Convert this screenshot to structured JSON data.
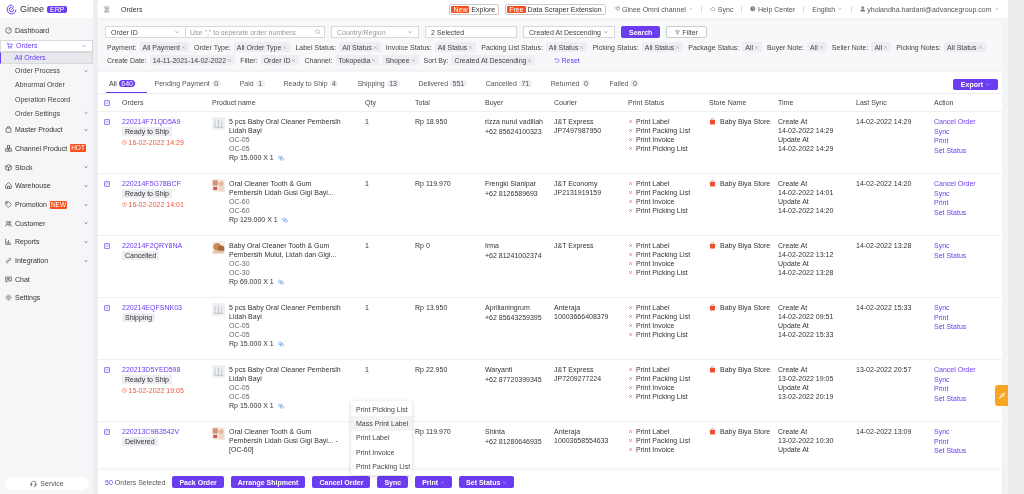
{
  "header": {
    "brand": "Ginee",
    "brand_badge": "ERP",
    "breadcrumb": "Orders",
    "promos": [
      {
        "badge": "New",
        "label": "Explore"
      },
      {
        "badge": "Free",
        "label": "Data Scraper Extension"
      }
    ],
    "menu": [
      {
        "kind": "channel",
        "label": "Ginee Omni channel"
      },
      {
        "kind": "sync",
        "label": "Sync"
      },
      {
        "kind": "help",
        "label": "Help Center"
      },
      {
        "kind": "language",
        "label": "English"
      },
      {
        "kind": "user",
        "label": "yholandha.hardani@advancegroup.com"
      }
    ]
  },
  "sidebar": {
    "items": [
      {
        "label": "Dashboard",
        "selected": false
      },
      {
        "label": "Orders",
        "selected": true,
        "expanded": true,
        "children": [
          {
            "label": "All Orders",
            "selected": true
          },
          {
            "label": "Order Process",
            "selected": false,
            "expanded": false
          },
          {
            "label": "Abnormal Order",
            "selected": false
          },
          {
            "label": "Operation Record",
            "selected": false
          },
          {
            "label": "Order Settings",
            "selected": false,
            "expanded": false
          }
        ]
      },
      {
        "label": "Master Product",
        "selected": false,
        "expanded": false
      },
      {
        "label": "Channel Product",
        "selected": false,
        "badge": "HOT"
      },
      {
        "label": "Stock",
        "selected": false,
        "expanded": false
      },
      {
        "label": "Warehouse",
        "selected": false,
        "expanded": false
      },
      {
        "label": "Promotion",
        "selected": false,
        "expanded": false,
        "badge": "NEW"
      },
      {
        "label": "Customer",
        "selected": false,
        "expanded": false
      },
      {
        "label": "Reports",
        "selected": false,
        "expanded": false
      },
      {
        "label": "Integration",
        "selected": false,
        "expanded": false
      },
      {
        "label": "Chat",
        "selected": false
      },
      {
        "label": "Settings",
        "selected": false
      }
    ],
    "service": "Service"
  },
  "search": {
    "field_select": "Order ID",
    "placeholder": "Use \",\" to seperate order numbers",
    "country_placeholder": "Country/Region",
    "channels": "2 Selected",
    "sort": "Created At Descending",
    "search_button": "Search",
    "filter_button": "Filter"
  },
  "filters": [
    {
      "label": "Payment:",
      "tags": [
        "All Payment"
      ]
    },
    {
      "label": "Order Type:",
      "tags": [
        "All Order Type"
      ]
    },
    {
      "label": "Label Status:",
      "tags": [
        "All Status"
      ]
    },
    {
      "label": "Invoice Status:",
      "tags": [
        "All Status"
      ]
    },
    {
      "label": "Packing List Status:",
      "tags": [
        "All Status"
      ]
    },
    {
      "label": "Picking Status:",
      "tags": [
        "All Status"
      ]
    },
    {
      "label": "Package Status:",
      "tags": [
        "All"
      ]
    },
    {
      "label": "Buyer Note:",
      "tags": [
        "All"
      ]
    },
    {
      "label": "Seller Note:",
      "tags": [
        "All"
      ]
    },
    {
      "label": "Picking Notes:",
      "tags": [
        "All Status"
      ]
    },
    {
      "label": "Create Date:",
      "tags": [
        "14-11-2021-14-02-2022"
      ]
    },
    {
      "label": "Filter:",
      "tags": [
        "Order ID"
      ]
    },
    {
      "label": "Channel:",
      "tags": [
        "Tokopedia",
        "Shopee"
      ]
    },
    {
      "label": "Sort By:",
      "tags": [
        "Created At Descending"
      ]
    }
  ],
  "reset": "Reset",
  "tabs": [
    {
      "label": "All",
      "count": "640",
      "selected": true
    },
    {
      "label": "Pending Payment",
      "count": "0",
      "selected": false
    },
    {
      "label": "Paid",
      "count": "1",
      "selected": false
    },
    {
      "label": "Ready to Ship",
      "count": "4",
      "selected": false
    },
    {
      "label": "Shipping",
      "count": "13",
      "selected": false
    },
    {
      "label": "Delivered",
      "count": "551",
      "selected": false
    },
    {
      "label": "Cancelled",
      "count": "71",
      "selected": false
    },
    {
      "label": "Returned",
      "count": "0",
      "selected": false
    },
    {
      "label": "Failed",
      "count": "0",
      "selected": false
    }
  ],
  "export_button": "Export",
  "table": {
    "all_selected": true,
    "columns": [
      "Orders",
      "Product name",
      "Qty",
      "Total",
      "Buyer",
      "Courier",
      "Print Status",
      "Store Name",
      "Time",
      "Last Sync",
      "Action"
    ],
    "rows": [
      {
        "selected": true,
        "order_id": "220214F71QD5A9",
        "status": "Ready to Ship",
        "deadline": "16-02-2022 14:29",
        "product": "5 pcs Baby Oral Cleaner Pembersih Lidah Bayi",
        "variants": [
          "OC-05",
          "OC-05"
        ],
        "price": "Rp 15.000 X 1",
        "qty": "1",
        "total": "Rp 18.950",
        "buyer": "rizza nurul vadillah",
        "phone": "+62 85624100323",
        "courier": "J&T Express",
        "tracking": "JP7497987950",
        "print_status": [
          {
            "label": "Print Label",
            "done": false
          },
          {
            "label": "Print Packing List",
            "done": false
          },
          {
            "label": "Print Invoice",
            "done": false
          },
          {
            "label": "Print Picking List",
            "done": false
          }
        ],
        "store": "Baby Biya Store",
        "time": [
          "Create At",
          "14-02-2022 14:29",
          "Update At",
          "14-02-2022 14:29"
        ],
        "last_sync": "14-02-2022 14:29",
        "actions": [
          "Cancel Order",
          "Sync",
          "Print",
          "Set Status"
        ]
      },
      {
        "selected": true,
        "order_id": "220214F5G78BCF",
        "status": "Ready to Ship",
        "deadline": "16-02-2022 14:01",
        "product": "Oral Cleaner Tooth & Gum Pembersih Lidah Gusi Gigi Bayi...",
        "variants": [
          "OC-60",
          "OC-60"
        ],
        "price": "Rp 129.000 X 1",
        "qty": "1",
        "total": "Rp 119.970",
        "buyer": "Frengki Sianipar",
        "phone": "+62 8126589693",
        "courier": "J&T Economy",
        "tracking": "JP2131919159",
        "print_status": [
          {
            "label": "Print Label",
            "done": false
          },
          {
            "label": "Print Packing List",
            "done": false
          },
          {
            "label": "Print Invoice",
            "done": false
          },
          {
            "label": "Print Picking List",
            "done": false
          }
        ],
        "store": "Baby Biya Store",
        "time": [
          "Create At",
          "14-02-2022 14:01",
          "Update At",
          "14-02-2022 14:20"
        ],
        "last_sync": "14-02-2022 14:20",
        "actions": [
          "Cancel Order",
          "Sync",
          "Print",
          "Set Status"
        ]
      },
      {
        "selected": true,
        "order_id": "220214F2QRY8NA",
        "status": "Cancelled",
        "product": "Baby Oral Cleaner Tooth & Gum Pembersih Mulut, Lidah dan Gigi...",
        "variants": [
          "OC-30",
          "OC-30"
        ],
        "price": "Rp 69.000 X 1",
        "qty": "1",
        "total": "Rp 0",
        "buyer": "Irma",
        "phone": "+62 81241002374",
        "courier": "J&T Express",
        "print_status": [
          {
            "label": "Print Label",
            "done": false
          },
          {
            "label": "Print Packing List",
            "done": false
          },
          {
            "label": "Print Invoice",
            "done": false
          },
          {
            "label": "Print Picking List",
            "done": false
          }
        ],
        "store": "Baby Biya Store",
        "time": [
          "Create At",
          "14-02-2022 13:12",
          "Update At",
          "14-02-2022 13:28"
        ],
        "last_sync": "14-02-2022 13:28",
        "actions": [
          "Sync",
          "Set Status"
        ]
      },
      {
        "selected": true,
        "order_id": "220214EQFSNK03",
        "status": "Shipping",
        "product": "5 pcs Baby Oral Cleaner Pembersih Lidah Bayi",
        "variants": [
          "OC-05",
          "OC-05"
        ],
        "price": "Rp 15.000 X 1",
        "qty": "1",
        "total": "Rp 13.950",
        "buyer": "Aprilianingrum",
        "phone": "+62 85643259395",
        "courier": "Anteraja",
        "tracking": "10003666408379",
        "print_status": [
          {
            "label": "Print Label",
            "done": false
          },
          {
            "label": "Print Packing List",
            "done": false
          },
          {
            "label": "Print Invoice",
            "done": false
          },
          {
            "label": "Print Picking List",
            "done": false
          }
        ],
        "store": "Baby Biya Store",
        "time": [
          "Create At",
          "14-02-2022 09:51",
          "Update At",
          "14-02-2022 15:33"
        ],
        "last_sync": "14-02-2022 15:33",
        "actions": [
          "Sync",
          "Print",
          "Set Status"
        ]
      },
      {
        "selected": true,
        "order_id": "220213D5YED598",
        "status": "Ready to Ship",
        "deadline": "15-02-2022 19:05",
        "product": "5 pcs Baby Oral Cleaner Pembersih Lidah Bayi",
        "variants": [
          "OC-05",
          "OC-05"
        ],
        "price": "Rp 15.000 X 1",
        "qty": "1",
        "total": "Rp 22.950",
        "buyer": "Waryanti",
        "phone": "+62 87720399345",
        "courier": "J&T Express",
        "tracking": "JP7209277224",
        "print_status": [
          {
            "label": "Print Label",
            "done": false
          },
          {
            "label": "Print Packing List",
            "done": false
          },
          {
            "label": "Print Invoice",
            "done": false
          },
          {
            "label": "Print Picking List",
            "done": false
          }
        ],
        "store": "Baby Biya Store",
        "time": [
          "Create At",
          "13-02-2022 19:05",
          "Update At",
          "13-02-2022 20:19"
        ],
        "last_sync": "13-02-2022 20:57",
        "actions": [
          "Cancel Order",
          "Sync",
          "Print",
          "Set Status"
        ]
      },
      {
        "selected": true,
        "order_id": "220213C9B3542V",
        "status": "Delivered",
        "product": "Oral Cleaner Tooth & Gum Pembersih Lidah Gusi Gigi Bayi... - [OC-60]",
        "total": "Rp 119.970",
        "buyer": "Shinta",
        "phone": "+62 81280646935",
        "courier": "Anteraja",
        "tracking": "10003658554633",
        "print_status": [
          {
            "label": "Print Label",
            "done": false
          },
          {
            "label": "Print Packing List",
            "done": false
          },
          {
            "label": "Print Invoice",
            "done": false
          }
        ],
        "store": "Baby Biya Store",
        "time": [
          "Create At",
          "13-02-2022 10:30",
          "Update At"
        ],
        "last_sync": "14-02-2022 13:09",
        "actions": [
          "Sync",
          "Print",
          "Set Status"
        ]
      }
    ]
  },
  "print_menu": [
    {
      "label": "Print Picking List",
      "selected": false
    },
    {
      "label": "Mass Print Label",
      "selected": true
    },
    {
      "label": "Print Label",
      "selected": false
    },
    {
      "label": "Print Invoice",
      "selected": false
    },
    {
      "label": "Print Packing List",
      "selected": false
    }
  ],
  "bulk_bar": {
    "count": "50",
    "label": "Orders Selected",
    "buttons": [
      {
        "label": "Pack Order",
        "dropdown": false
      },
      {
        "label": "Arrange Shipment",
        "dropdown": false
      },
      {
        "label": "Cancel Order",
        "dropdown": false
      },
      {
        "label": "Sync",
        "dropdown": false
      },
      {
        "label": "Print",
        "dropdown": true
      },
      {
        "label": "Set Status",
        "dropdown": true
      }
    ]
  }
}
